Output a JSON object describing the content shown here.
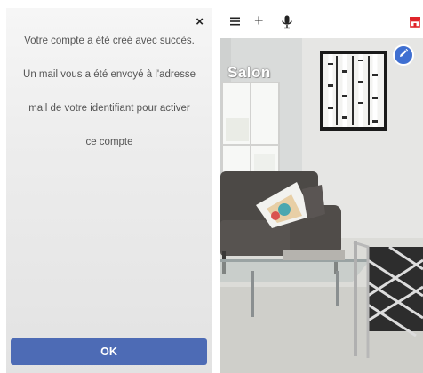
{
  "dialog": {
    "message_lines": [
      "Votre compte a été créé avec succès.",
      "Un mail vous a été envoyé à l'adresse",
      "mail de votre identifiant pour activer",
      "ce compte"
    ],
    "close_symbol": "×",
    "ok_label": "OK",
    "ok_color": "#4d6bb5"
  },
  "toolbar": {
    "icons": [
      "menu-icon",
      "plus-icon",
      "microphone-icon",
      "store-icon"
    ],
    "plus_symbol": "+",
    "store_color": "#e0242a"
  },
  "room": {
    "label": "Salon",
    "edit_icon": "pencil-icon",
    "edit_color": "#3f6fd1"
  }
}
